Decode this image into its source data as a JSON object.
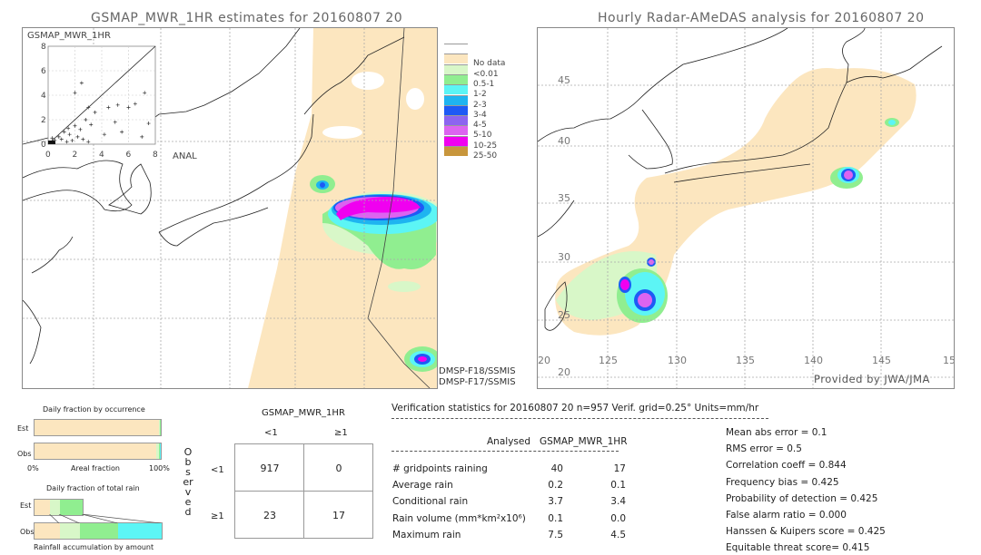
{
  "left_map": {
    "title": "GSMAP_MWR_1HR estimates for 20160807 20",
    "inset_label": "GSMAP_MWR_1HR",
    "x_axis_label": "ANAL",
    "inset_ticks": [
      "0",
      "2",
      "4",
      "6",
      "8"
    ],
    "sensors": [
      "DMSP-F18/SSMIS",
      "DMSP-F17/SSMIS"
    ]
  },
  "right_map": {
    "title": "Hourly Radar-AMeDAS analysis for 20160807 20",
    "lat_labels": [
      "45",
      "40",
      "35",
      "30",
      "25",
      "20"
    ],
    "lon_labels": [
      "20",
      "125",
      "130",
      "135",
      "140",
      "145",
      "15"
    ],
    "credit": "Provided by JWA/JMA"
  },
  "legend": {
    "items": [
      {
        "label": "",
        "color": "#ffffff"
      },
      {
        "label": "No data",
        "color": "#fce6bf"
      },
      {
        "label": "<0.01",
        "color": "#d8f7c8"
      },
      {
        "label": "0.5-1",
        "color": "#90ee90"
      },
      {
        "label": "1-2",
        "color": "#5cf5f5"
      },
      {
        "label": "2-3",
        "color": "#1eb4f0"
      },
      {
        "label": "3-4",
        "color": "#1e5af5"
      },
      {
        "label": "4-5",
        "color": "#8c64f0"
      },
      {
        "label": "5-10",
        "color": "#dc64f0"
      },
      {
        "label": "10-25",
        "color": "#f000f0"
      },
      {
        "label": "25-50",
        "color": "#c8963c"
      }
    ]
  },
  "occurrence": {
    "title": "Daily fraction by occurrence",
    "est_label": "Est",
    "obs_label": "Obs",
    "axis_left": "0%",
    "axis_mid": "Areal fraction",
    "axis_right": "100%"
  },
  "total_rain": {
    "title": "Daily fraction of total rain",
    "est_label": "Est",
    "obs_label": "Obs",
    "caption": "Rainfall accumulation by amount"
  },
  "contingency": {
    "model": "GSMAP_MWR_1HR",
    "col_headers": [
      "<1",
      "≥1"
    ],
    "row_headers": [
      "<1",
      "≥1"
    ],
    "observed_label": "Observed",
    "cells": [
      [
        "917",
        "0"
      ],
      [
        "23",
        "17"
      ]
    ]
  },
  "verification": {
    "header": "Verification statistics for 20160807 20   n=957   Verif. grid=0.25°   Units=mm/hr",
    "col_analysed": "Analysed",
    "col_model": "GSMAP_MWR_1HR",
    "rows": [
      {
        "label": "# gridpoints raining",
        "analysed": "40",
        "model": "17"
      },
      {
        "label": "Average rain",
        "analysed": "0.2",
        "model": "0.1"
      },
      {
        "label": "Conditional rain",
        "analysed": "3.7",
        "model": "3.4"
      },
      {
        "label": "Rain volume (mm*km²x10⁶)",
        "analysed": "0.1",
        "model": "0.0"
      },
      {
        "label": "Maximum rain",
        "analysed": "7.5",
        "model": "4.5"
      }
    ],
    "scores": [
      "Mean abs error = 0.1",
      "RMS error = 0.5",
      "Correlation coeff = 0.844",
      "Frequency bias = 0.425",
      "Probability of detection = 0.425",
      "False alarm ratio = 0.000",
      "Hanssen & Kuipers score = 0.425",
      "Equitable threat score= 0.415"
    ]
  },
  "chart_data": [
    {
      "type": "scatter",
      "title": "GSMAP_MWR_1HR",
      "xlabel": "ANAL",
      "ylabel": "GSMAP_MWR_1HR",
      "xlim": [
        0,
        8
      ],
      "ylim": [
        0,
        8
      ],
      "x_ticks": [
        "0",
        "2",
        "4",
        "6",
        "8"
      ],
      "y_ticks": [
        "0",
        "2",
        "4",
        "6",
        "8"
      ],
      "grid": true,
      "points": [
        [
          0.3,
          0.5
        ],
        [
          0.5,
          0.3
        ],
        [
          0.8,
          0.6
        ],
        [
          1.0,
          0.4
        ],
        [
          1.2,
          1.0
        ],
        [
          1.4,
          0.2
        ],
        [
          1.6,
          0.8
        ],
        [
          1.8,
          0.3
        ],
        [
          2.0,
          1.5
        ],
        [
          2.2,
          0.6
        ],
        [
          2.4,
          1.2
        ],
        [
          2.6,
          0.4
        ],
        [
          2.8,
          2.0
        ],
        [
          3.0,
          0.2
        ],
        [
          3.2,
          1.6
        ],
        [
          3.5,
          2.6
        ],
        [
          4.2,
          0.8
        ],
        [
          4.5,
          3.0
        ],
        [
          5.0,
          1.8
        ],
        [
          5.2,
          3.2
        ],
        [
          5.5,
          1.0
        ],
        [
          6.0,
          3.0
        ],
        [
          6.5,
          3.3
        ],
        [
          7.0,
          0.6
        ],
        [
          7.5,
          1.7
        ],
        [
          7.2,
          4.2
        ],
        [
          3.0,
          3.0
        ],
        [
          2.5,
          5.0
        ],
        [
          2.0,
          4.2
        ],
        [
          1.5,
          1.3
        ]
      ]
    },
    {
      "type": "bar",
      "title": "Daily fraction by occurrence",
      "xlabel": "Areal fraction",
      "categories": [
        "Est",
        "Obs"
      ],
      "series": [
        {
          "name": "No data",
          "values": [
            98.5,
            96.5
          ]
        },
        {
          "name": "<0.01",
          "values": [
            1.0,
            2.0
          ]
        },
        {
          "name": "0.5-1",
          "values": [
            0.5,
            1.0
          ]
        },
        {
          "name": "1-2",
          "values": [
            0.0,
            0.5
          ]
        }
      ],
      "xlim": [
        0,
        100
      ]
    },
    {
      "type": "bar",
      "title": "Daily fraction of total rain",
      "xlabel": "Rainfall accumulation by amount",
      "categories": [
        "Est",
        "Obs"
      ],
      "series": [
        {
          "name": "No data",
          "values": [
            12.5,
            20.0
          ]
        },
        {
          "name": "<0.01",
          "values": [
            7.5,
            16.0
          ]
        },
        {
          "name": "0.5-1",
          "values": [
            18.0,
            30.0
          ]
        },
        {
          "name": "1-2",
          "values": [
            0.0,
            34.0
          ]
        }
      ],
      "xlim": [
        0,
        100
      ]
    }
  ]
}
